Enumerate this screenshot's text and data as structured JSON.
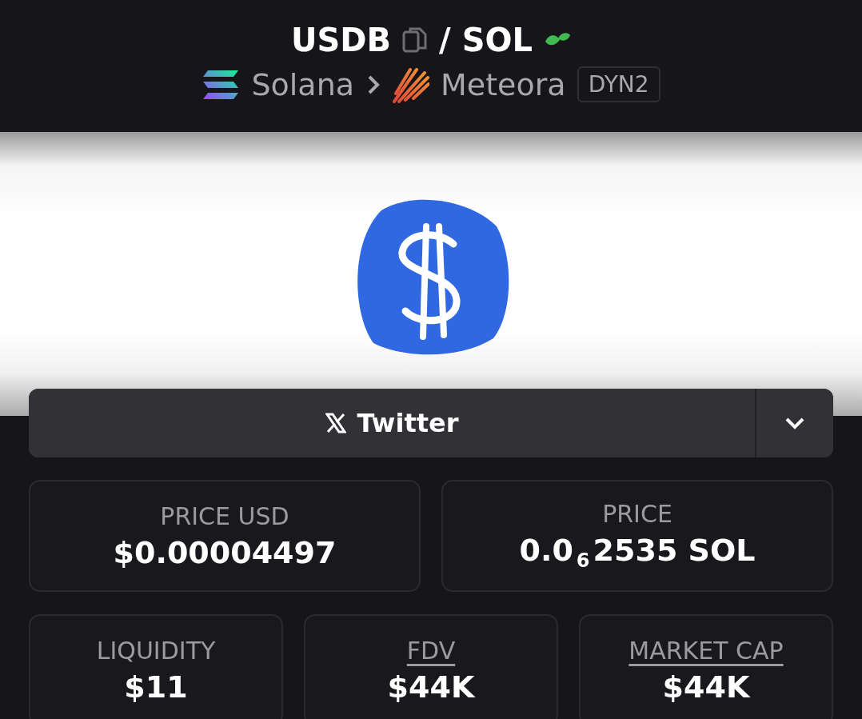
{
  "pair": {
    "base": "USDB",
    "separator": "/",
    "quote": "SOL"
  },
  "route": {
    "chain": "Solana",
    "dex": "Meteora",
    "badge": "DYN2"
  },
  "social": {
    "label": "Twitter"
  },
  "stats": [
    {
      "label": "PRICE USD",
      "value": "$0.00004497",
      "underlined": false
    },
    {
      "label": "PRICE",
      "value": "0.0$_{6}$2535 SOL",
      "underlined": false
    },
    {
      "label": "LIQUIDITY",
      "value": "$11",
      "underlined": false
    },
    {
      "label": "FDV",
      "value": "$44K",
      "underlined": true
    },
    {
      "label": "MARKET CAP",
      "value": "$44K",
      "underlined": true
    }
  ]
}
